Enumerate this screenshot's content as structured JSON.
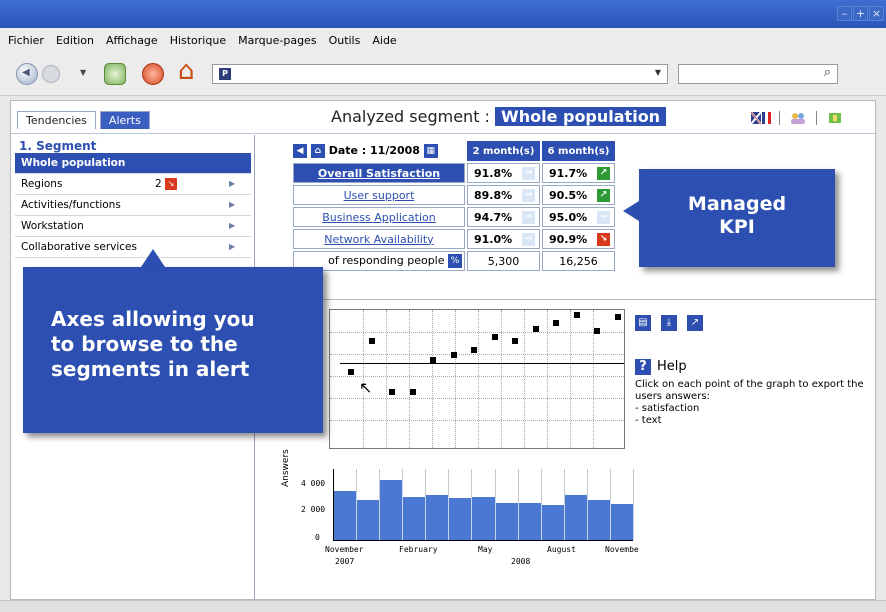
{
  "menu": {
    "items": [
      "Fichier",
      "Edition",
      "Affichage",
      "Historique",
      "Marque-pages",
      "Outils",
      "Aide"
    ]
  },
  "header": {
    "tabs": [
      {
        "label": "Tendencies"
      },
      {
        "label": "Alerts"
      }
    ],
    "analyzed_label": "Analyzed segment :",
    "analyzed_value": "Whole population"
  },
  "sidebar": {
    "section_title": "1. Segment",
    "items": [
      {
        "label": "Whole population"
      },
      {
        "label": "Regions",
        "count": "2"
      },
      {
        "label": "Activities/functions"
      },
      {
        "label": "Workstation"
      },
      {
        "label": "Collaborative services"
      }
    ]
  },
  "kpi": {
    "date_label": "Date : 11/2008",
    "col1": "2 month(s)",
    "col2": "6 month(s)",
    "rows": [
      {
        "name": "Overall Satisfaction",
        "v1": "91.8%",
        "v2": "91.7%",
        "t1": "neutral",
        "t2": "up"
      },
      {
        "name": "User support",
        "v1": "89.8%",
        "v2": "90.5%",
        "t1": "neutral",
        "t2": "up"
      },
      {
        "name": "Business Application",
        "v1": "94.7%",
        "v2": "95.0%",
        "t1": "neutral",
        "t2": "neutral"
      },
      {
        "name": "Network Availability",
        "v1": "91.0%",
        "v2": "90.9%",
        "t1": "neutral",
        "t2": "down"
      }
    ],
    "respond_label": "of responding people",
    "respond_v1": "5,300",
    "respond_v2": "16,256"
  },
  "help": {
    "title": "Help",
    "text1": "Click on each point of the graph to export the users answers:",
    "text2": "- satisfaction",
    "text3": "- text"
  },
  "callouts": {
    "left_line1": "Axes allowing you",
    "left_line2": "to browse to the",
    "left_line3": "segments in alert",
    "right_line1": "Managed",
    "right_line2": "KPI"
  },
  "chart_data": [
    {
      "type": "scatter",
      "title": "",
      "target_level": 0.35,
      "points": [
        0.57,
        0.26,
        0.77,
        0.77,
        0.45,
        0.4,
        0.35,
        0.22,
        0.26,
        0.14,
        0.08,
        0.0,
        0.16,
        0.02
      ]
    },
    {
      "type": "bar",
      "ylabel": "Answers",
      "ylim": [
        0,
        5000
      ],
      "yticks": [
        "4 000",
        "2 000",
        "0"
      ],
      "xticks": [
        "November",
        "February",
        "May",
        "August",
        "Novembe"
      ],
      "xyears": [
        "2007",
        "2008"
      ],
      "values": [
        3400,
        2800,
        4200,
        3000,
        3100,
        2900,
        3000,
        2600,
        2600,
        2400,
        3100,
        2800,
        2500
      ]
    }
  ]
}
